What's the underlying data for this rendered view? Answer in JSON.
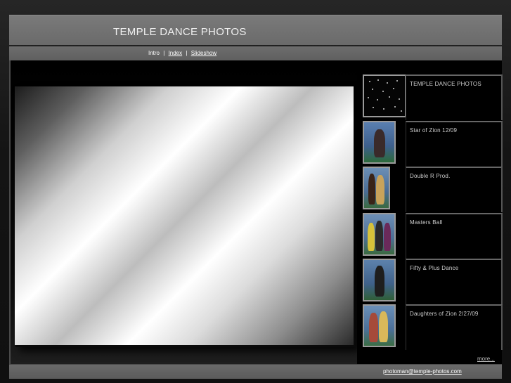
{
  "header": {
    "title": "TEMPLE DANCE PHOTOS"
  },
  "nav": {
    "intro": "Intro",
    "separator": "|",
    "index": "Index",
    "slideshow": "Slideshow"
  },
  "albums": [
    {
      "label": "TEMPLE DANCE PHOTOS"
    },
    {
      "label": "Star of Zion 12/09"
    },
    {
      "label": "Double R Prod."
    },
    {
      "label": "Masters Ball"
    },
    {
      "label": "Fifty & Plus Dance"
    },
    {
      "label": "Daughters of Zion 2/27/09"
    }
  ],
  "sidebar": {
    "more_link": "more..."
  },
  "footer": {
    "email": "photoman@temple-photos.com"
  },
  "colors": {
    "header_bg": "#6f6f6f",
    "page_bg": "#101010",
    "sidebar_bg": "#000000",
    "label_text": "#cfcfcf"
  }
}
